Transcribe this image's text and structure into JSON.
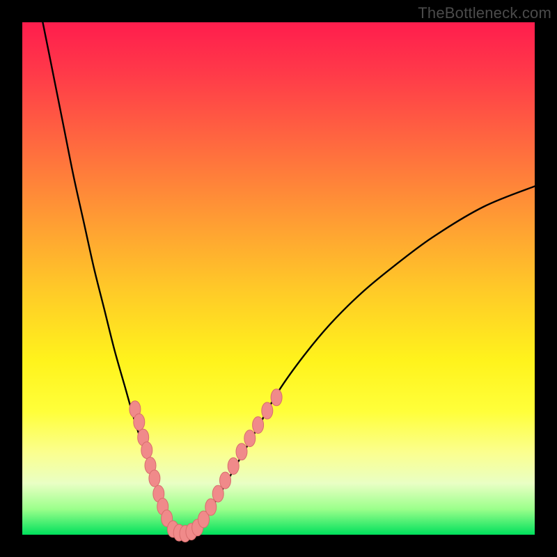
{
  "attribution": "TheBottleneck.com",
  "colors": {
    "curve": "#000000",
    "marker_fill": "#f08a8a",
    "marker_stroke": "#d86d6d"
  },
  "chart_data": {
    "type": "line",
    "title": "",
    "xlabel": "",
    "ylabel": "",
    "xlim": [
      0,
      100
    ],
    "ylim": [
      0,
      100
    ],
    "series": [
      {
        "name": "bottleneck-curve",
        "x": [
          4,
          6,
          8,
          10,
          12,
          14,
          16,
          18,
          20,
          22,
          24,
          26,
          27,
          28,
          29,
          30,
          31,
          32,
          33,
          35,
          38,
          42,
          46,
          50,
          55,
          60,
          66,
          72,
          80,
          90,
          100
        ],
        "y": [
          100,
          90,
          80,
          70,
          61,
          52,
          44,
          36,
          29,
          22,
          16,
          10,
          7,
          4.5,
          2.5,
          1.2,
          0.4,
          0,
          0.6,
          2.5,
          7,
          14,
          21,
          28,
          35,
          41,
          47,
          52,
          58,
          64,
          68
        ]
      }
    ],
    "markers_left": [
      {
        "x": 22.0,
        "y": 24.5
      },
      {
        "x": 22.8,
        "y": 22.0
      },
      {
        "x": 23.6,
        "y": 19.0
      },
      {
        "x": 24.3,
        "y": 16.5
      },
      {
        "x": 25.0,
        "y": 13.5
      },
      {
        "x": 25.8,
        "y": 11.0
      },
      {
        "x": 26.6,
        "y": 8.0
      },
      {
        "x": 27.4,
        "y": 5.5
      },
      {
        "x": 28.2,
        "y": 3.2
      }
    ],
    "markers_bottom": [
      {
        "x": 29.4,
        "y": 1.1
      },
      {
        "x": 30.6,
        "y": 0.4
      },
      {
        "x": 31.8,
        "y": 0.2
      },
      {
        "x": 33.0,
        "y": 0.6
      },
      {
        "x": 34.2,
        "y": 1.4
      }
    ],
    "markers_right": [
      {
        "x": 35.4,
        "y": 3.0
      },
      {
        "x": 36.8,
        "y": 5.4
      },
      {
        "x": 38.2,
        "y": 8.0
      },
      {
        "x": 39.6,
        "y": 10.6
      },
      {
        "x": 41.2,
        "y": 13.4
      },
      {
        "x": 42.8,
        "y": 16.2
      },
      {
        "x": 44.4,
        "y": 18.8
      },
      {
        "x": 46.0,
        "y": 21.4
      },
      {
        "x": 47.8,
        "y": 24.2
      },
      {
        "x": 49.6,
        "y": 26.8
      }
    ]
  }
}
